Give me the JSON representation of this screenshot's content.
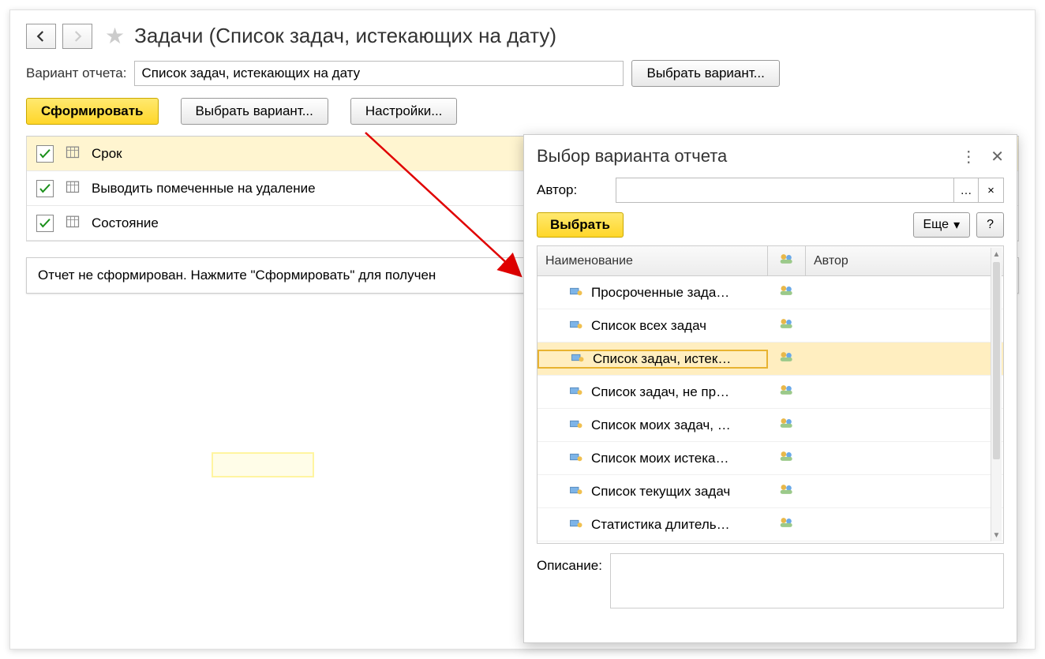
{
  "page_title": "Задачи (Список задач, истекающих на дату)",
  "variant": {
    "label": "Вариант отчета:",
    "value": "Список задач, истекающих на дату",
    "choose_button": "Выбрать вариант..."
  },
  "toolbar": {
    "generate": "Сформировать",
    "choose_variant": "Выбрать вариант...",
    "settings": "Настройки..."
  },
  "filters": [
    {
      "label": "Срок",
      "checked": true,
      "selected": true
    },
    {
      "label": "Выводить помеченные на удаление",
      "checked": true,
      "selected": false
    },
    {
      "label": "Состояние",
      "checked": true,
      "selected": false
    }
  ],
  "report_message": "Отчет не сформирован. Нажмите \"Сформировать\" для получен",
  "dialog": {
    "title": "Выбор варианта отчета",
    "author_label": "Автор:",
    "author_value": "",
    "select_button": "Выбрать",
    "more_button": "Еще",
    "help_button": "?",
    "columns": {
      "name": "Наименование",
      "author": "Автор"
    },
    "rows": [
      {
        "label": "Просроченные зада…",
        "selected": false
      },
      {
        "label": "Список всех задач",
        "selected": false
      },
      {
        "label": "Список задач, истек…",
        "selected": true
      },
      {
        "label": "Список задач, не пр…",
        "selected": false
      },
      {
        "label": "Список моих задач, …",
        "selected": false
      },
      {
        "label": "Список моих истека…",
        "selected": false
      },
      {
        "label": "Список текущих задач",
        "selected": false
      },
      {
        "label": "Статистика длитель…",
        "selected": false
      }
    ],
    "description_label": "Описание:",
    "description_value": ""
  }
}
